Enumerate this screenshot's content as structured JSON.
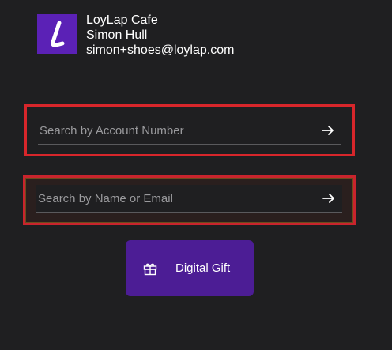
{
  "header": {
    "logo_icon": "loylap-logo-icon",
    "brand_color": "#5b21b6",
    "business_name": "LoyLap Cafe",
    "user_name": "Simon Hull",
    "user_email": "simon+shoes@loylap.com"
  },
  "search_account": {
    "placeholder": "Search by Account Number",
    "value": "",
    "submit_icon": "arrow-right-icon",
    "highlight_color": "#d7262b"
  },
  "search_name": {
    "placeholder": "Search by Name or Email",
    "value": "",
    "submit_icon": "arrow-right-icon",
    "highlight_color": "#c9242d"
  },
  "gift": {
    "icon": "gift-icon",
    "label": "Digital Gift",
    "color": "#4c1d95"
  }
}
